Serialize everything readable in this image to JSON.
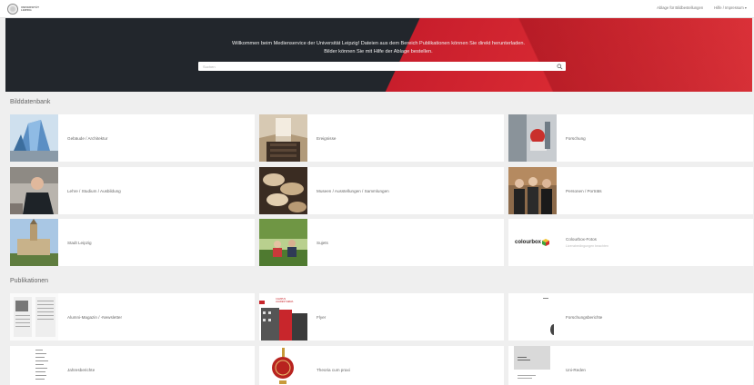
{
  "topbar": {
    "logo_text": "UNIVERSITÄT LEIPZIG",
    "links": [
      "Ablage für Bildbestellungen",
      "Hilfe / Impressum ▾"
    ]
  },
  "hero": {
    "line1": "Willkommen beim Medienservice der Universität Leipzig! Dateien aus dem Bereich Publikationen können Sie direkt herunterladen.",
    "line2": "Bilder können Sie mit Hilfe der Ablage bestellen.",
    "search_placeholder": "Suchen"
  },
  "bilddatenbank": {
    "title": "Bilddatenbank",
    "cards": [
      {
        "label": "Gebäude / Architektur"
      },
      {
        "label": "Ereignisse"
      },
      {
        "label": "Forschung"
      },
      {
        "label": "Lehre / Studium / Ausbildung"
      },
      {
        "label": "Museen / Ausstellungen / Sammlungen"
      },
      {
        "label": "Personen / Porträts"
      },
      {
        "label": "Stadt Leipzig"
      },
      {
        "label": "Sujets"
      },
      {
        "label": "Colourbox-Fotos",
        "sub": "Lizenzbedingungen beachten"
      }
    ]
  },
  "publikationen": {
    "title": "Publikationen",
    "cards": [
      {
        "label": "Alumni-Magazin / -Newsletter"
      },
      {
        "label": "Flyer"
      },
      {
        "label": "Forschungsberichte"
      },
      {
        "label": "Jahresberichte"
      },
      {
        "label": "Theoria cum praxi"
      },
      {
        "label": "Uni-Reden"
      }
    ]
  },
  "colourbox_logo": "colourbox",
  "flyer_cover_text": "CAMPUS JAHRESTHEMA"
}
